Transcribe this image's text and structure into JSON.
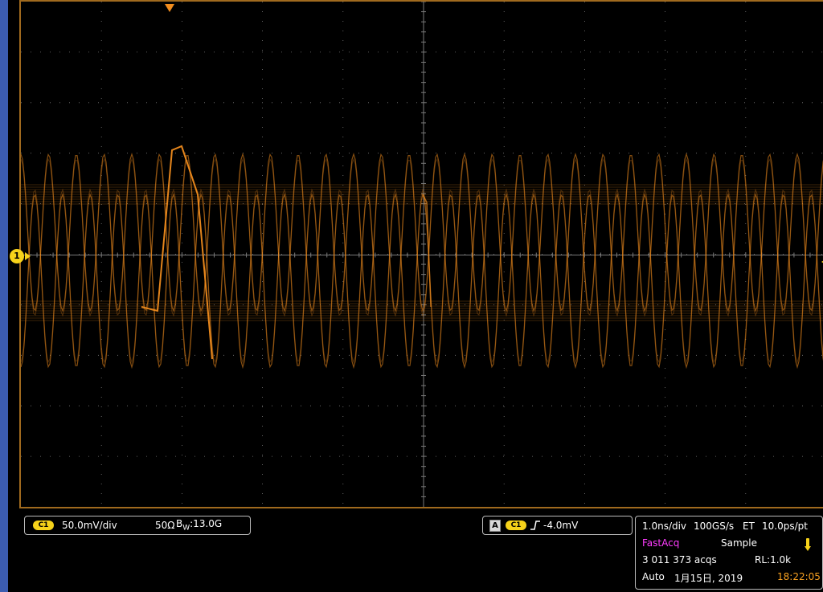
{
  "channel_marker": "1",
  "vertical": {
    "channel_badge": "C1",
    "scale": "50.0mV/div",
    "termination": "50Ω",
    "bandwidth_prefix": "B",
    "bandwidth_sub": "W",
    "bandwidth_value": ":13.0G"
  },
  "trigger": {
    "source_box": "A",
    "channel_badge": "C1",
    "slope_icon": "rising-edge-icon",
    "level": "-4.0mV"
  },
  "horizontal": {
    "time_per_div": "1.0ns/div",
    "sample_rate": "100GS/s",
    "mode": "ET",
    "resolution": "10.0ps/pt",
    "acq_mode": "FastAcq",
    "sample_mode": "Sample",
    "acqs": "3 011 373 acqs",
    "record_length": "RL:1.0k",
    "run_mode": "Auto",
    "date": "1月15日, 2019",
    "time": "18:22:05"
  },
  "colors": {
    "trace": "#f08c1e",
    "grid": "#7a7a7a",
    "channel": "#f6d21a",
    "fastacq": "#ff3cff",
    "clock": "#f7a020"
  }
}
